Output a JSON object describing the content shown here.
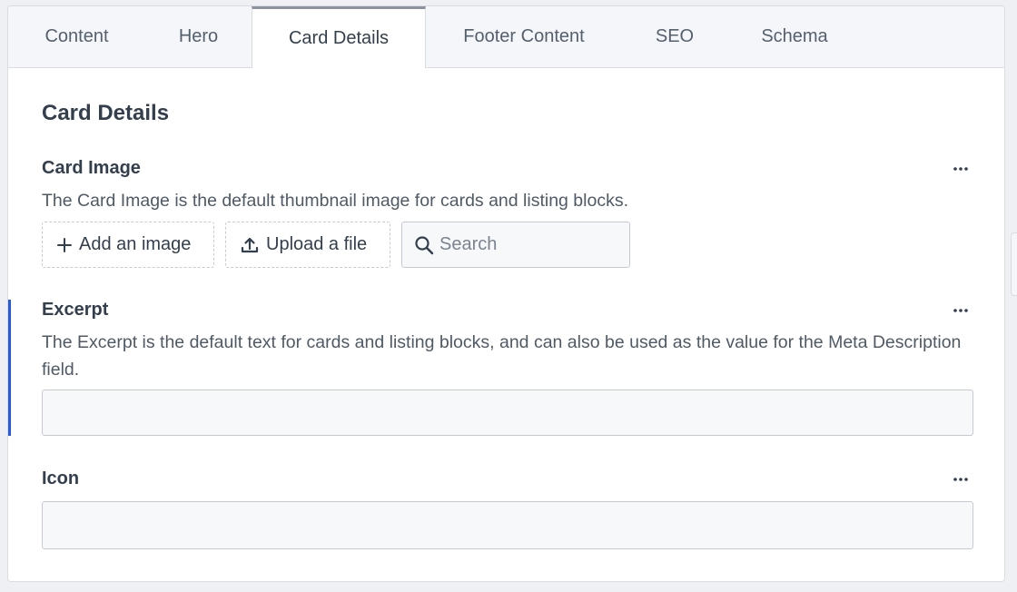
{
  "tabs": [
    {
      "label": "Content"
    },
    {
      "label": "Hero"
    },
    {
      "label": "Card Details"
    },
    {
      "label": "Footer Content"
    },
    {
      "label": "SEO"
    },
    {
      "label": "Schema"
    }
  ],
  "active_tab": "Card Details",
  "section": {
    "title": "Card Details"
  },
  "fields": {
    "card_image": {
      "label": "Card Image",
      "description": "The Card Image is the default thumbnail image for cards and listing blocks.",
      "add_label": "Add an image",
      "upload_label": "Upload a file",
      "search_placeholder": "Search"
    },
    "excerpt": {
      "label": "Excerpt",
      "description": "The Excerpt is the default text for cards and listing blocks, and can also be used as the value for the Meta Description field.",
      "value": ""
    },
    "icon": {
      "label": "Icon",
      "value": ""
    }
  },
  "icons": {
    "more": "ellipsis-icon",
    "add": "plus-icon",
    "upload": "upload-icon",
    "search": "search-icon"
  },
  "colors": {
    "accent": "#2a5bd7",
    "tab_active_indicator": "#8a939e"
  }
}
